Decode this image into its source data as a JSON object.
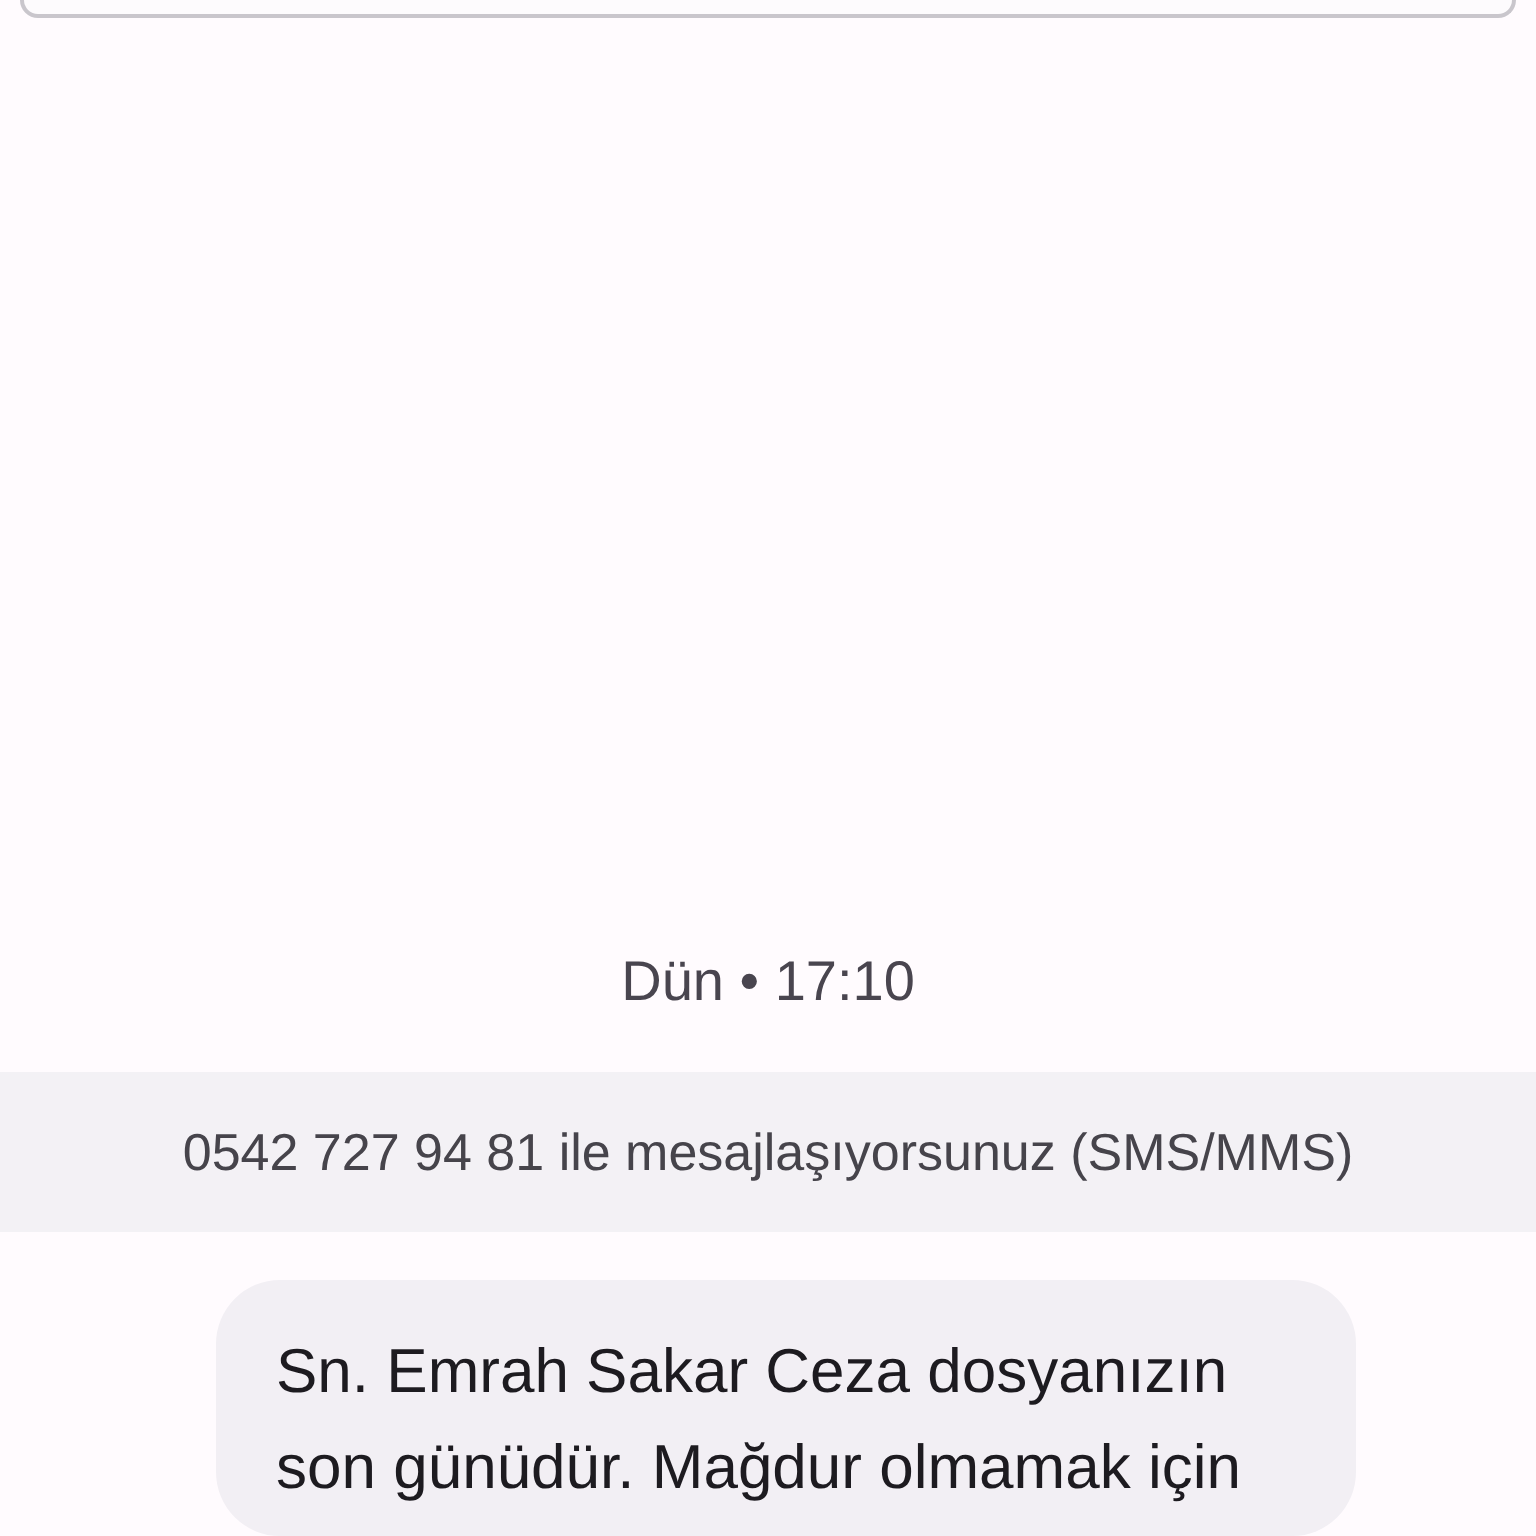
{
  "timestamp": "Dün • 17:10",
  "banner": "0542 727 94 81 ile mesajlaşıyorsunuz (SMS/MMS)",
  "messages": [
    {
      "text": "Sn. Emrah Sakar Ceza dosyanızın son günüdür. Mağdur olmamak için"
    }
  ]
}
